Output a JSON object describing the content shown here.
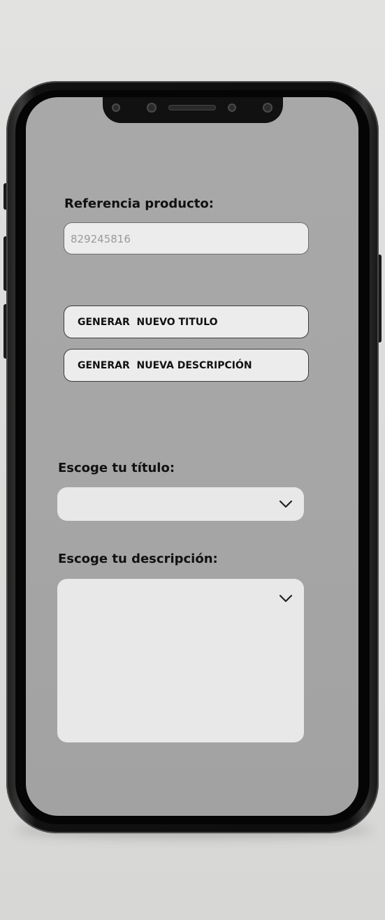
{
  "form": {
    "reference_label": "Referencia producto:",
    "reference_value": "829245816",
    "generate_title_label": "GENERAR  NUEVO TITULO",
    "generate_description_label": "GENERAR  NUEVA DESCRIPCIÓN",
    "choose_title_label": "Escoge tu título:",
    "choose_title_value": "",
    "choose_description_label": "Escoge tu descripción:",
    "choose_description_value": ""
  },
  "icons": {
    "title_dropdown": "chevron-down-icon",
    "description_dropdown": "chevron-down-icon"
  },
  "colors": {
    "screen_background": "#a8a8a8",
    "field_background": "#ececec",
    "text": "#111111",
    "placeholder_text": "#9a9a9a",
    "device_frame": "#0d0d0d"
  }
}
